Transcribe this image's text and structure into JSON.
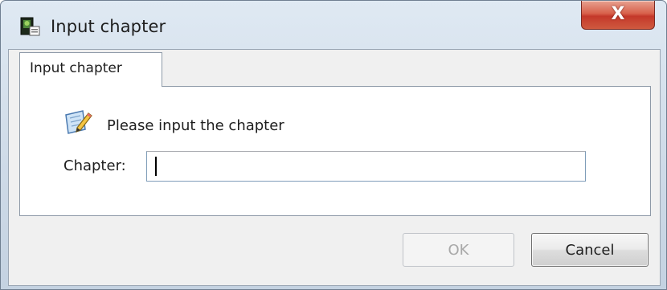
{
  "window": {
    "title": "Input chapter",
    "close_glyph": "X",
    "icons": {
      "app": "app-icon",
      "close": "close-icon"
    }
  },
  "tabs": [
    {
      "label": "Input chapter",
      "selected": true
    }
  ],
  "prompt": {
    "icon": "edit-note-icon",
    "text": "Please input the chapter"
  },
  "form": {
    "chapter_label": "Chapter:",
    "chapter_value": ""
  },
  "buttons": {
    "ok_label": "OK",
    "ok_enabled": false,
    "cancel_label": "Cancel"
  },
  "colors": {
    "close_button": "#c4382a",
    "disabled_text": "#a8a8a8"
  }
}
